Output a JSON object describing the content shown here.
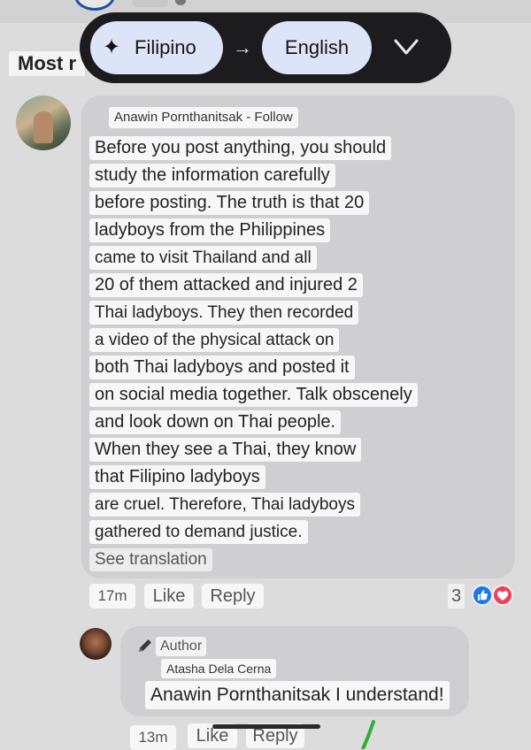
{
  "translation_bar": {
    "source_language": "Filipino",
    "target_language": "English",
    "swap_arrow": "→"
  },
  "sort_label": "Most r",
  "comment": {
    "author": "Anawin Pornthanitsak - Follow",
    "lines": [
      "Before you post anything, you should",
      "study the information carefully",
      "before posting. The truth is that 20",
      "ladyboys from the Philippines",
      "came to visit Thailand and all",
      "20 of them attacked and injured 2",
      "Thai ladyboys. They then recorded",
      "a video of the physical attack on",
      "both Thai ladyboys and posted it",
      "on social media together. Talk obscenely",
      "and look down on Thai people.",
      "When they see a Thai, they know",
      "that Filipino ladyboys",
      "are cruel. Therefore, Thai ladyboys",
      "gathered to demand justice."
    ],
    "see_translation": "See translation",
    "time": "17m",
    "like_label": "Like",
    "reply_label": "Reply",
    "reaction_count": "3"
  },
  "reply": {
    "badge": "Author",
    "author": "Atasha Dela Cerna",
    "text": "Anawin Pornthanitsak I understand!",
    "time": "13m",
    "like_label": "Like",
    "reply_label": "Reply"
  },
  "icons": {
    "sparkle": "sparkle-icon",
    "chevron": "chevron-down-icon",
    "pencil": "pencil-icon",
    "like_reaction": "thumbs-up-icon",
    "love_reaction": "heart-icon"
  },
  "colors": {
    "bar_background": "#1c1c1e",
    "pill_background": "#dce5f7",
    "like_blue": "#1877f2",
    "love_red": "#f33e58"
  }
}
